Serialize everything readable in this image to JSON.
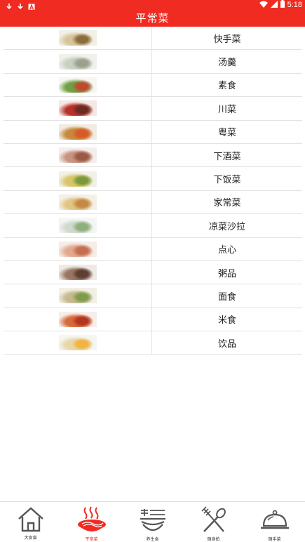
{
  "status_bar": {
    "time": "5:18",
    "icons": [
      "download-icon",
      "download-icon",
      "font-icon",
      "wifi-icon",
      "signal-icon",
      "battery-icon"
    ]
  },
  "header": {
    "title": "平常菜"
  },
  "categories": [
    {
      "label": "快手菜",
      "thumb_colors": [
        "#f3efe6",
        "#d7c49a",
        "#8a6d3e"
      ]
    },
    {
      "label": "汤羹",
      "thumb_colors": [
        "#f1f1ec",
        "#c9cfc2",
        "#9aa28e"
      ]
    },
    {
      "label": "素食",
      "thumb_colors": [
        "#f6f7f0",
        "#6fa045",
        "#c14a2e"
      ]
    },
    {
      "label": "川菜",
      "thumb_colors": [
        "#f5e8e4",
        "#b9322a",
        "#6b2a22"
      ]
    },
    {
      "label": "粤菜",
      "thumb_colors": [
        "#f0ece3",
        "#c7893e",
        "#d85a28"
      ]
    },
    {
      "label": "下酒菜",
      "thumb_colors": [
        "#f4eeec",
        "#c8937f",
        "#9b5a45"
      ]
    },
    {
      "label": "下饭菜",
      "thumb_colors": [
        "#f2f1e8",
        "#d8c56a",
        "#7a9a3c"
      ]
    },
    {
      "label": "家常菜",
      "thumb_colors": [
        "#f5f0e7",
        "#e1c583",
        "#c48a45"
      ]
    },
    {
      "label": "凉菜沙拉",
      "thumb_colors": [
        "#f4f6f3",
        "#cfd9cc",
        "#8eb07c"
      ]
    },
    {
      "label": "点心",
      "thumb_colors": [
        "#f6ece8",
        "#e3a98f",
        "#c56e50"
      ]
    },
    {
      "label": "粥品",
      "thumb_colors": [
        "#eeeae5",
        "#9b7563",
        "#5c3f33"
      ]
    },
    {
      "label": "面食",
      "thumb_colors": [
        "#f2f0e6",
        "#c6b98e",
        "#7e9c4d"
      ]
    },
    {
      "label": "米食",
      "thumb_colors": [
        "#f7eeea",
        "#d56b3c",
        "#b3351f"
      ]
    },
    {
      "label": "饮品",
      "thumb_colors": [
        "#f5f5f2",
        "#e9d7a8",
        "#f2b441"
      ]
    }
  ],
  "tab_bar": {
    "active_color": "#f02b22",
    "tabs": [
      {
        "label": "大食谱",
        "icon": "home-icon",
        "active": false
      },
      {
        "label": "平常菜",
        "icon": "hot-dish-icon",
        "active": true
      },
      {
        "label": "养生食",
        "icon": "bowl-icon",
        "active": false
      },
      {
        "label": "随身拍",
        "icon": "fork-spoon-icon",
        "active": false
      },
      {
        "label": "随手菜",
        "icon": "cloche-icon",
        "active": false
      }
    ]
  },
  "colors": {
    "header_red": "#f02b22",
    "divider": "#e2e2e2"
  }
}
